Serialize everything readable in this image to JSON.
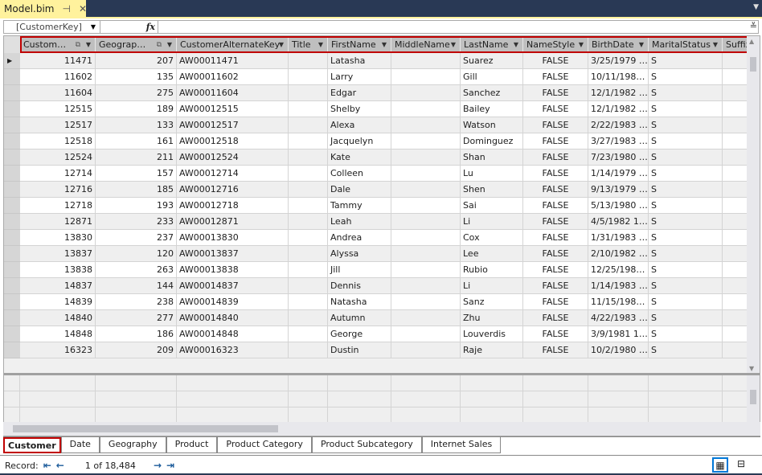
{
  "document_tab": {
    "title": "Model.bim",
    "pin": "⊣",
    "close": "✕"
  },
  "formula_bar": {
    "selected_column": "[CustomerKey]",
    "fx": "fx"
  },
  "columns": [
    "Custom…",
    "Geograp…",
    "CustomerAlternateKey",
    "Title",
    "FirstName",
    "MiddleName",
    "LastName",
    "NameStyle",
    "BirthDate",
    "MaritalStatus",
    "Suffix"
  ],
  "rows": [
    [
      "11471",
      "207",
      "AW00011471",
      "",
      "Latasha",
      "",
      "Suarez",
      "FALSE",
      "3/25/1979 …",
      "S",
      ""
    ],
    [
      "11602",
      "135",
      "AW00011602",
      "",
      "Larry",
      "",
      "Gill",
      "FALSE",
      "10/11/198…",
      "S",
      ""
    ],
    [
      "11604",
      "275",
      "AW00011604",
      "",
      "Edgar",
      "",
      "Sanchez",
      "FALSE",
      "12/1/1982 …",
      "S",
      ""
    ],
    [
      "12515",
      "189",
      "AW00012515",
      "",
      "Shelby",
      "",
      "Bailey",
      "FALSE",
      "12/1/1982 …",
      "S",
      ""
    ],
    [
      "12517",
      "133",
      "AW00012517",
      "",
      "Alexa",
      "",
      "Watson",
      "FALSE",
      "2/22/1983 …",
      "S",
      ""
    ],
    [
      "12518",
      "161",
      "AW00012518",
      "",
      "Jacquelyn",
      "",
      "Dominguez",
      "FALSE",
      "3/27/1983 …",
      "S",
      ""
    ],
    [
      "12524",
      "211",
      "AW00012524",
      "",
      "Kate",
      "",
      "Shan",
      "FALSE",
      "7/23/1980 …",
      "S",
      ""
    ],
    [
      "12714",
      "157",
      "AW00012714",
      "",
      "Colleen",
      "",
      "Lu",
      "FALSE",
      "1/14/1979 …",
      "S",
      ""
    ],
    [
      "12716",
      "185",
      "AW00012716",
      "",
      "Dale",
      "",
      "Shen",
      "FALSE",
      "9/13/1979 …",
      "S",
      ""
    ],
    [
      "12718",
      "193",
      "AW00012718",
      "",
      "Tammy",
      "",
      "Sai",
      "FALSE",
      "5/13/1980 …",
      "S",
      ""
    ],
    [
      "12871",
      "233",
      "AW00012871",
      "",
      "Leah",
      "",
      "Li",
      "FALSE",
      "4/5/1982 1…",
      "S",
      ""
    ],
    [
      "13830",
      "237",
      "AW00013830",
      "",
      "Andrea",
      "",
      "Cox",
      "FALSE",
      "1/31/1983 …",
      "S",
      ""
    ],
    [
      "13837",
      "120",
      "AW00013837",
      "",
      "Alyssa",
      "",
      "Lee",
      "FALSE",
      "2/10/1982 …",
      "S",
      ""
    ],
    [
      "13838",
      "263",
      "AW00013838",
      "",
      "Jill",
      "",
      "Rubio",
      "FALSE",
      "12/25/198…",
      "S",
      ""
    ],
    [
      "14837",
      "144",
      "AW00014837",
      "",
      "Dennis",
      "",
      "Li",
      "FALSE",
      "1/14/1983 …",
      "S",
      ""
    ],
    [
      "14839",
      "238",
      "AW00014839",
      "",
      "Natasha",
      "",
      "Sanz",
      "FALSE",
      "11/15/198…",
      "S",
      ""
    ],
    [
      "14840",
      "277",
      "AW00014840",
      "",
      "Autumn",
      "",
      "Zhu",
      "FALSE",
      "4/22/1983 …",
      "S",
      ""
    ],
    [
      "14848",
      "186",
      "AW00014848",
      "",
      "George",
      "",
      "Louverdis",
      "FALSE",
      "3/9/1981 1…",
      "S",
      ""
    ],
    [
      "16323",
      "209",
      "AW00016323",
      "",
      "Dustin",
      "",
      "Raje",
      "FALSE",
      "10/2/1980 …",
      "S",
      ""
    ]
  ],
  "sheet_tabs": [
    "Customer",
    "Date",
    "Geography",
    "Product",
    "Product Category",
    "Product Subcategory",
    "Internet Sales"
  ],
  "status": {
    "record_label": "Record:",
    "record_position": "1 of 18,484"
  },
  "colors": {
    "highlight": "#c00000",
    "title_bar": "#293955",
    "doc_tab": "#fff29d"
  }
}
